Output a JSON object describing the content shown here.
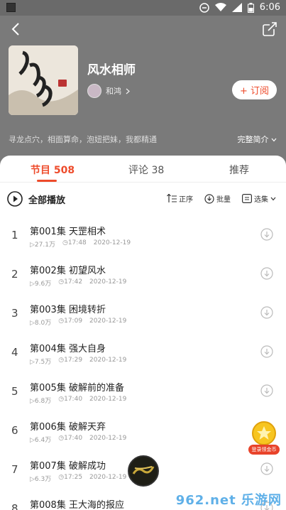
{
  "status": {
    "time": "6:06"
  },
  "album": {
    "title": "风水相师",
    "author": "和鸿",
    "subscribe_label": "+ 订阅",
    "description": "寻龙点穴，相面算命，泡妞把妹，我都精通",
    "more_label": "完整简介"
  },
  "tabs": [
    {
      "label": "节目 508",
      "active": true
    },
    {
      "label": "评论 38",
      "active": false
    },
    {
      "label": "推荐",
      "active": false
    }
  ],
  "toolbar": {
    "play_all": "全部播放",
    "order": "正序",
    "batch": "批量",
    "select": "选集"
  },
  "episodes": [
    {
      "num": "1",
      "title": "第001集 天罡相术",
      "plays": "27.1万",
      "duration": "17:48",
      "date": "2020-12-19"
    },
    {
      "num": "2",
      "title": "第002集 初望风水",
      "plays": "9.6万",
      "duration": "17:42",
      "date": "2020-12-19"
    },
    {
      "num": "3",
      "title": "第003集 困境转折",
      "plays": "8.0万",
      "duration": "17:09",
      "date": "2020-12-19"
    },
    {
      "num": "4",
      "title": "第004集 强大自身",
      "plays": "7.5万",
      "duration": "17:29",
      "date": "2020-12-19"
    },
    {
      "num": "5",
      "title": "第005集 破解前的准备",
      "plays": "6.8万",
      "duration": "17:40",
      "date": "2020-12-19"
    },
    {
      "num": "6",
      "title": "第006集 破解天弃",
      "plays": "6.4万",
      "duration": "17:40",
      "date": "2020-12-19"
    },
    {
      "num": "7",
      "title": "第007集 破解成功",
      "plays": "6.3万",
      "duration": "17:25",
      "date": "2020-12-19"
    },
    {
      "num": "8",
      "title": "第008集 王大海的报应",
      "plays": "",
      "duration": "",
      "date": ""
    }
  ],
  "coin_badge": "登录领金币",
  "watermark": "962.net 乐游网",
  "colors": {
    "accent": "#ee4b2b",
    "header_bg": "#7a7a7a"
  }
}
